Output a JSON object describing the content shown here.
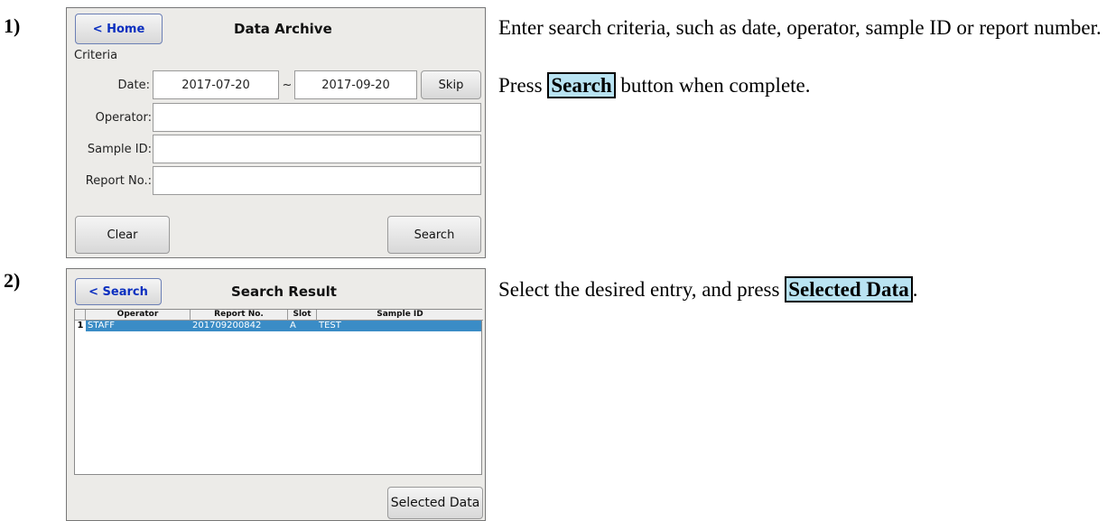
{
  "step1": {
    "number": "1)",
    "screen": {
      "home_button": "< Home",
      "title": "Data Archive",
      "criteria_label": "Criteria",
      "date_label": "Date:",
      "date_from": "2017-07-20",
      "date_sep": "~",
      "date_to": "2017-09-20",
      "skip_button": "Skip",
      "operator_label": "Operator:",
      "operator_value": "",
      "sample_id_label": "Sample ID:",
      "sample_id_value": "",
      "report_label": "Report No.:",
      "report_value": "",
      "clear_button": "Clear",
      "search_button": "Search"
    },
    "description": {
      "line1": "Enter search criteria, such as date, operator, sample ID or report number.",
      "line2_pre": "Press ",
      "line2_key": "Search",
      "line2_post": " button when complete."
    }
  },
  "step2": {
    "number": "2)",
    "screen": {
      "back_button": "< Search",
      "title": "Search Result",
      "columns": [
        "Operator",
        "Report No.",
        "Slot",
        "Sample ID"
      ],
      "rows": [
        {
          "index": "1",
          "operator": "STAFF",
          "report_no": "201709200842",
          "slot": "A",
          "sample_id": "TEST"
        }
      ],
      "selected_button": "Selected Data"
    },
    "description": {
      "pre": "Select the desired entry, and press ",
      "key": "Selected Data",
      "post": "."
    }
  }
}
